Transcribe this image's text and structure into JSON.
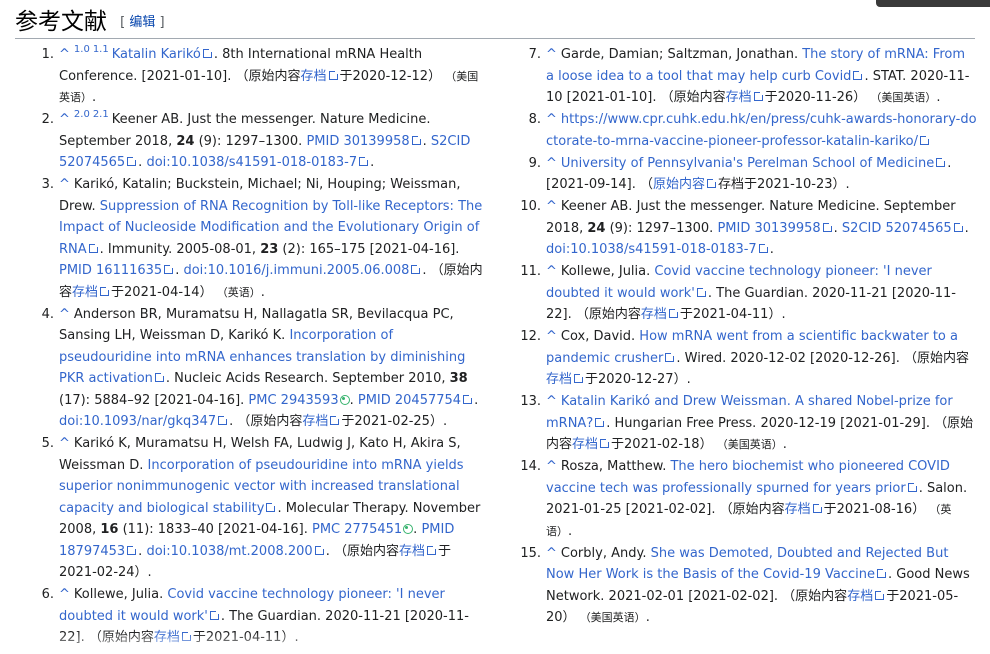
{
  "header": {
    "title": "参考文献",
    "edit_label": "编辑"
  },
  "refs": {
    "r1": {
      "num": "1.",
      "caret": "^",
      "s1": "1.0",
      "s2": "1.1",
      "link": "Katalin Karikó",
      "t1": ". 8th International mRNA Health Conference. [2021-01-10]. （原始内容",
      "archive": "存档",
      "t2": "于2020-12-12）",
      "lang": "（美国英语）",
      "t3": "."
    },
    "r2": {
      "num": "2.",
      "caret": "^",
      "s1": "2.0",
      "s2": "2.1",
      "t1": "Keener AB. Just the messenger. Nature Medicine. September 2018, ",
      "vol": "24",
      "t2": " (9): 1297–1300. ",
      "pmid": "PMID 30139958",
      "t3": ". ",
      "s2cid": "S2CID 52074565",
      "t4": ". ",
      "doi": "doi:10.1038/s41591-018-0183-7",
      "t5": "."
    },
    "r3": {
      "num": "3.",
      "caret": "^",
      "t1": "Karikó, Katalin; Buckstein, Michael; Ni, Houping; Weissman, Drew. ",
      "link": "Suppression of RNA Recognition by Toll-like Receptors: The Impact of Nucleoside Modification and the Evolutionary Origin of RNA",
      "t2": ". Immunity. 2005-08-01, ",
      "vol": "23",
      "t3": " (2): 165–175 [2021-04-16]. ",
      "pmid": "PMID 16111635",
      "t4": ". ",
      "doi": "doi:10.1016/j.immuni.2005.06.008",
      "t5": ". （原始内容",
      "archive": "存档",
      "t6": "于2021-04-14）",
      "lang": "（英语）",
      "t7": "."
    },
    "r4": {
      "num": "4.",
      "caret": "^",
      "t1": "Anderson BR, Muramatsu H, Nallagatla SR, Bevilacqua PC, Sansing LH, Weissman D, Karikó K. ",
      "link": "Incorporation of pseudouridine into mRNA enhances translation by diminishing PKR activation",
      "t2": ". Nucleic Acids Research. September 2010, ",
      "vol": "38",
      "t3": " (17): 5884–92 [2021-04-16]. ",
      "pmc": "PMC 2943593",
      "t4": ". ",
      "pmid": "PMID 20457754",
      "t5": ". ",
      "doi": "doi:10.1093/nar/gkq347",
      "t6": ". （原始内容",
      "archive": "存档",
      "t7": "于2021-02-25）."
    },
    "r5": {
      "num": "5.",
      "caret": "^",
      "t1": "Karikó K, Muramatsu H, Welsh FA, Ludwig J, Kato H, Akira S, Weissman D. ",
      "link": "Incorporation of pseudouridine into mRNA yields superior nonimmunogenic vector with increased translational capacity and biological stability",
      "t2": ". Molecular Therapy. November 2008, ",
      "vol": "16",
      "t3": " (11): 1833–40 [2021-04-16]. ",
      "pmc": "PMC 2775451",
      "t4": ". ",
      "pmid": "PMID 18797453",
      "t5": ". ",
      "doi": "doi:10.1038/mt.2008.200",
      "t6": ". （原始内容",
      "archive": "存档",
      "t7": "于2021-02-24）."
    },
    "r6": {
      "num": "6.",
      "caret": "^",
      "t1": "Kollewe, Julia. ",
      "link": "Covid vaccine technology pioneer: 'I never doubted it would work'",
      "t2": ". The Guardian. 2020-11-21 [2020-11-22]. （原始内容",
      "archive": "存档",
      "t3": "于2021-04-11）."
    },
    "r7": {
      "num": "7.",
      "caret": "^",
      "t1": "Garde, Damian; Saltzman, Jonathan. ",
      "link": "The story of mRNA: From a loose idea to a tool that may help curb Covid",
      "t2": ". STAT. 2020-11-10 [2021-01-10]. （原始内容",
      "archive": "存档",
      "t3": "于2020-11-26）",
      "lang": "（美国英语）",
      "t4": "."
    },
    "r8": {
      "num": "8.",
      "caret": "^",
      "link": "https://www.cpr.cuhk.edu.hk/en/press/cuhk-awards-honorary-doctorate-to-mrna-vaccine-pioneer-professor-katalin-kariko/"
    },
    "r9": {
      "num": "9.",
      "caret": "^",
      "link": "University of Pennsylvania's Perelman School of Medicine",
      "t1": ". [2021-09-14]. （",
      "archive": "原始内容",
      "t2": "存档于2021-10-23）."
    },
    "r10": {
      "num": "10.",
      "caret": "^",
      "t1": "Keener AB. Just the messenger. Nature Medicine. September 2018, ",
      "vol": "24",
      "t2": " (9): 1297–1300. ",
      "pmid": "PMID 30139958",
      "t3": ". ",
      "s2cid": "S2CID 52074565",
      "t4": ". ",
      "doi": "doi:10.1038/s41591-018-0183-7",
      "t5": "."
    },
    "r11": {
      "num": "11.",
      "caret": "^",
      "t1": "Kollewe, Julia. ",
      "link": "Covid vaccine technology pioneer: 'I never doubted it would work'",
      "t2": ". The Guardian. 2020-11-21 [2020-11-22]. （原始内容",
      "archive": "存档",
      "t3": "于2021-04-11）."
    },
    "r12": {
      "num": "12.",
      "caret": "^",
      "t1": "Cox, David. ",
      "link": "How mRNA went from a scientific backwater to a pandemic crusher",
      "t2": ". Wired. 2020-12-02 [2020-12-26]. （原始内容",
      "archive": "存档",
      "t3": "于2020-12-27）."
    },
    "r13": {
      "num": "13.",
      "caret": "^",
      "link": "Katalin Karikó and Drew Weissman. A shared Nobel-prize for mRNA?",
      "t1": ". Hungarian Free Press. 2020-12-19 [2021-01-29]. （原始内容",
      "archive": "存档",
      "t2": "于2021-02-18）",
      "lang": "（美国英语）",
      "t3": "."
    },
    "r14": {
      "num": "14.",
      "caret": "^",
      "t1": "Rosza, Matthew. ",
      "link": "The hero biochemist who pioneered COVID vaccine tech was professionally spurned for years prior",
      "t2": ". Salon. 2021-01-25 [2021-02-02]. （原始内容",
      "archive": "存档",
      "t3": "于2021-08-16）",
      "lang": "（英语）",
      "t4": "."
    },
    "r15": {
      "num": "15.",
      "caret": "^",
      "t1": "Corbly, Andy. ",
      "link": "She was Demoted, Doubted and Rejected But Now Her Work is the Basis of the Covid-19 Vaccine",
      "t2": ". Good News Network. 2021-02-01 [2021-02-02]. （原始内容",
      "archive": "存档",
      "t3": "于2021-05-20）",
      "lang": "（美国英语）",
      "t4": "."
    }
  }
}
